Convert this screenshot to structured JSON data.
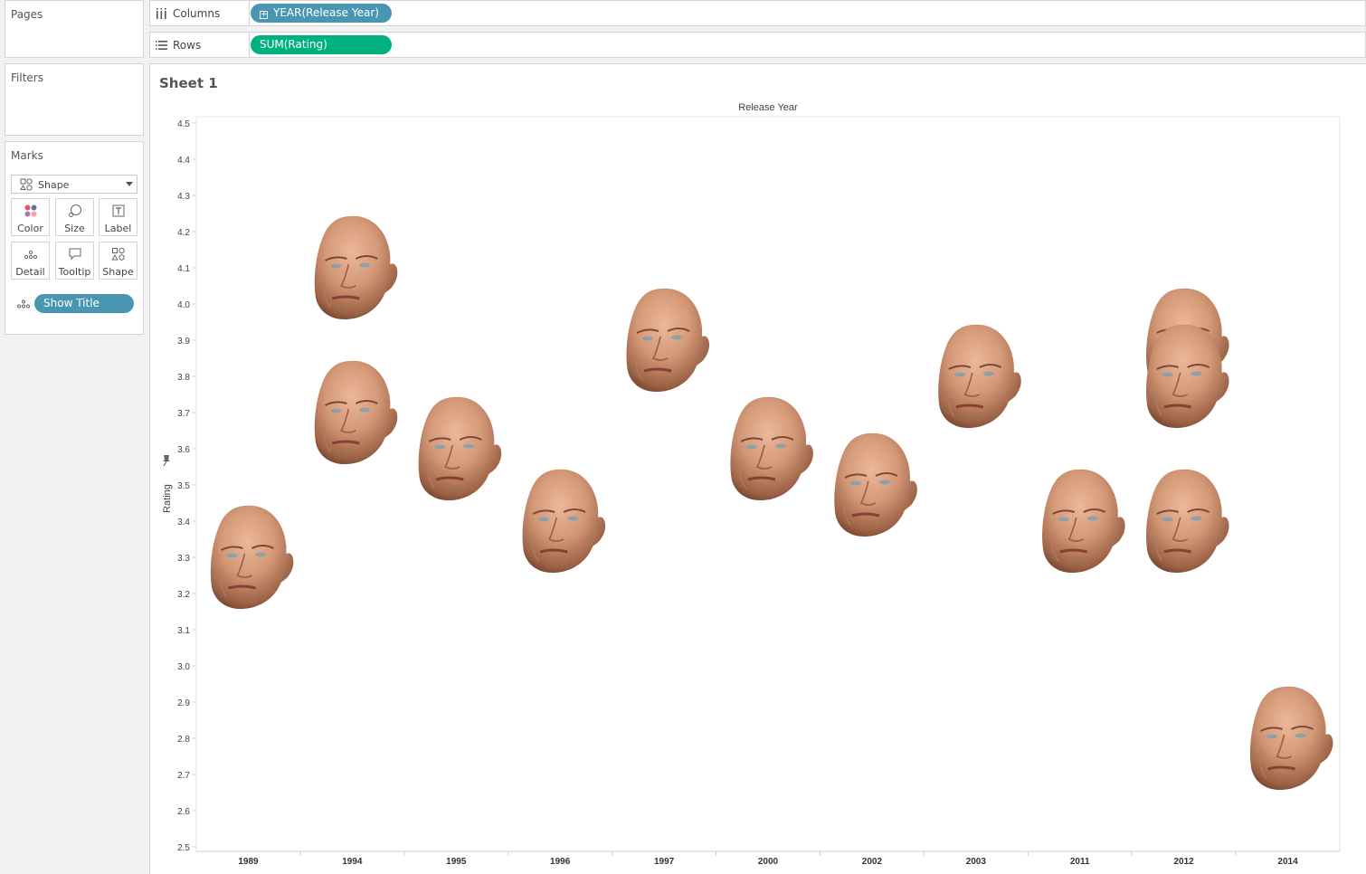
{
  "sidebar": {
    "pages_title": "Pages",
    "filters_title": "Filters",
    "marks": {
      "title": "Marks",
      "mark_type": "Shape",
      "buttons": {
        "color": "Color",
        "size": "Size",
        "label": "Label",
        "detail": "Detail",
        "tooltip": "Tooltip",
        "shape": "Shape"
      },
      "detail_pill": "Show Title"
    }
  },
  "shelves": {
    "columns_label": "Columns",
    "columns_pill": "YEAR(Release Year)",
    "rows_label": "Rows",
    "rows_pill": "SUM(Rating)"
  },
  "sheet": {
    "title": "Sheet 1"
  },
  "colors": {
    "pill_dimension": "#4996b2",
    "pill_measure": "#00b180"
  },
  "chart_data": {
    "type": "scatter",
    "marker": "bald-man-face-image",
    "xlabel": "Release Year",
    "ylabel": "Rating",
    "ylim": [
      2.5,
      4.5
    ],
    "yticks": [
      "4.5",
      "4.4",
      "4.3",
      "4.2",
      "4.1",
      "4.0",
      "3.9",
      "3.8",
      "3.7",
      "3.6",
      "3.5",
      "3.4",
      "3.3",
      "3.2",
      "3.1",
      "3.0",
      "2.9",
      "2.8",
      "2.7",
      "2.6",
      "2.5"
    ],
    "categories": [
      "1989",
      "1994",
      "1995",
      "1996",
      "1997",
      "2000",
      "2002",
      "2003",
      "2011",
      "2012",
      "2014"
    ],
    "points": [
      {
        "x": "1989",
        "y": 3.3
      },
      {
        "x": "1994",
        "y": 4.1
      },
      {
        "x": "1994",
        "y": 3.7
      },
      {
        "x": "1995",
        "y": 3.6
      },
      {
        "x": "1996",
        "y": 3.4
      },
      {
        "x": "1997",
        "y": 3.9
      },
      {
        "x": "2000",
        "y": 3.6
      },
      {
        "x": "2002",
        "y": 3.5
      },
      {
        "x": "2003",
        "y": 3.8
      },
      {
        "x": "2011",
        "y": 3.4
      },
      {
        "x": "2012",
        "y": 3.9
      },
      {
        "x": "2012",
        "y": 3.8
      },
      {
        "x": "2012",
        "y": 3.4
      },
      {
        "x": "2014",
        "y": 2.8
      }
    ],
    "grid": false
  }
}
